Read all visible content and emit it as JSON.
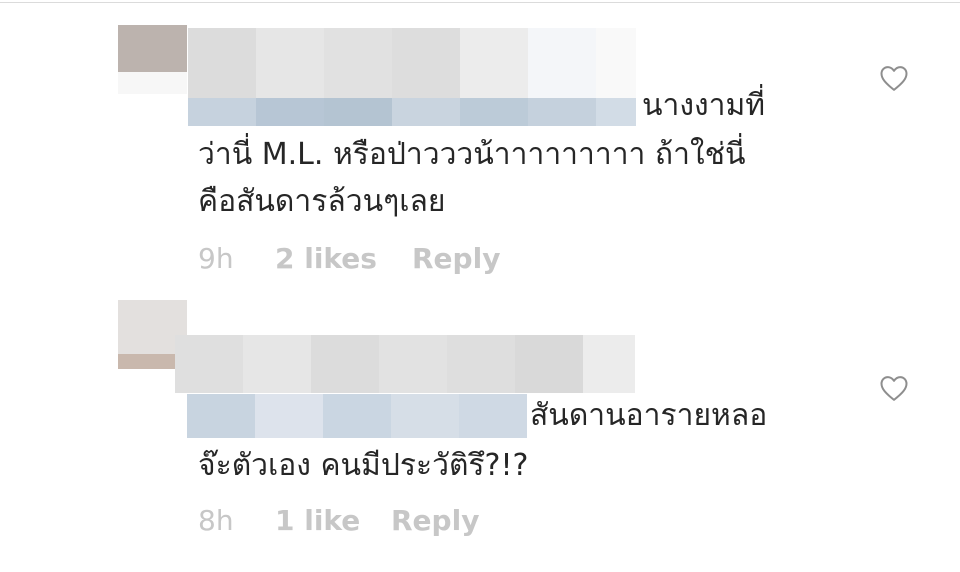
{
  "comments": [
    {
      "text_lines": [
        "นางงามที่",
        "ว่านี่ M.L. หรือป่าวววน้าาาาาาาาา ถ้าใช่นี่",
        "คือสันดารล้วนๆเลย"
      ],
      "time": "9h",
      "likes": "2 likes",
      "reply_label": "Reply"
    },
    {
      "text_lines": [
        "สันดานอารายหลอ",
        "จ๊ะตัวเอง  คนมีประวัติรึ?!?"
      ],
      "time": "8h",
      "likes": "1 like",
      "reply_label": "Reply"
    }
  ],
  "icons": {
    "like": "heart-outline-icon"
  },
  "colors": {
    "text": "#262626",
    "meta": "#c7c7c7",
    "divider": "#dbdbdb"
  }
}
